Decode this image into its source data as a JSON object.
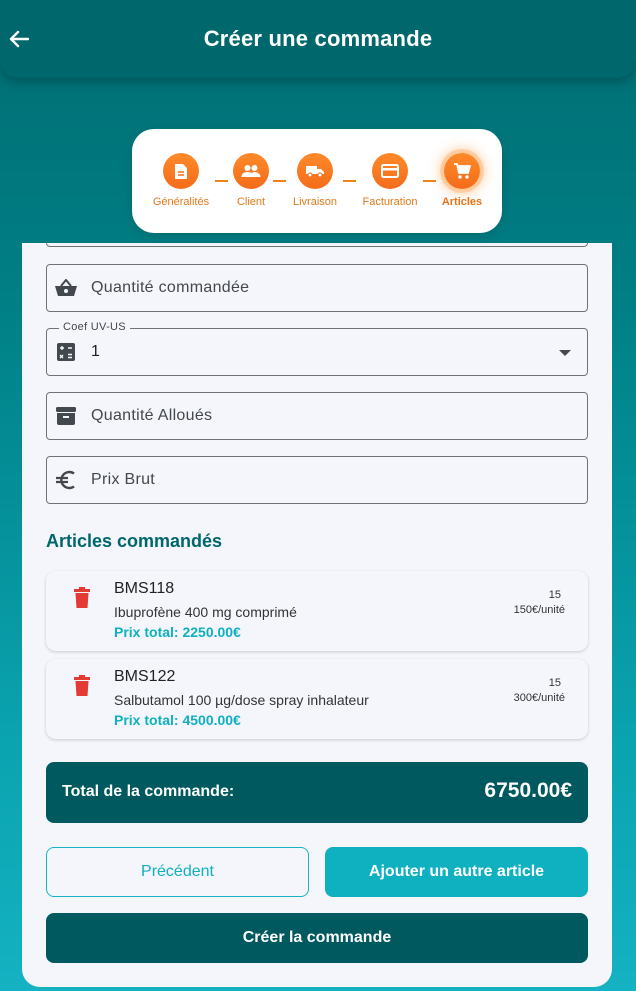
{
  "appbar": {
    "title": "Créer une commande"
  },
  "stepper": {
    "steps": [
      {
        "label": "Généralités",
        "icon": "document-icon"
      },
      {
        "label": "Client",
        "icon": "people-icon"
      },
      {
        "label": "Livraison",
        "icon": "truck-icon"
      },
      {
        "label": "Facturation",
        "icon": "credit-card-icon"
      },
      {
        "label": "Articles",
        "icon": "cart-icon",
        "active": true
      }
    ],
    "accent_color": "#f46c1a"
  },
  "form": {
    "quantite_commandee": {
      "placeholder": "Quantité commandée",
      "icon": "basket-icon"
    },
    "coef": {
      "label": "Coef UV-US",
      "value": "1",
      "icon": "calculator-icon"
    },
    "quantite_allouee": {
      "placeholder": "Quantité Alloués",
      "icon": "archive-icon"
    },
    "prix_brut": {
      "placeholder": "Prix Brut",
      "icon": "euro-icon"
    }
  },
  "articles": {
    "title": "Articles commandés",
    "items": [
      {
        "code": "BMS118",
        "description": "Ibuprofène 400 mg comprimé",
        "total": "Prix total: 2250.00€",
        "quantity": "15",
        "unit_price": "150€/unité"
      },
      {
        "code": "BMS122",
        "description": "Salbutamol 100 µg/dose spray inhalateur",
        "total": "Prix total: 4500.00€",
        "quantity": "15",
        "unit_price": "300€/unité"
      }
    ]
  },
  "summary": {
    "label": "Total de la commande:",
    "value": "6750.00€"
  },
  "buttons": {
    "previous": "Précédent",
    "add_article": "Ajouter un autre article",
    "create_order": "Créer la commande"
  },
  "colors": {
    "primary_dark": "#00595e",
    "accent_cyan": "#0fb0c0",
    "delete_red": "#e53935",
    "step_orange": "#f46c1a"
  }
}
